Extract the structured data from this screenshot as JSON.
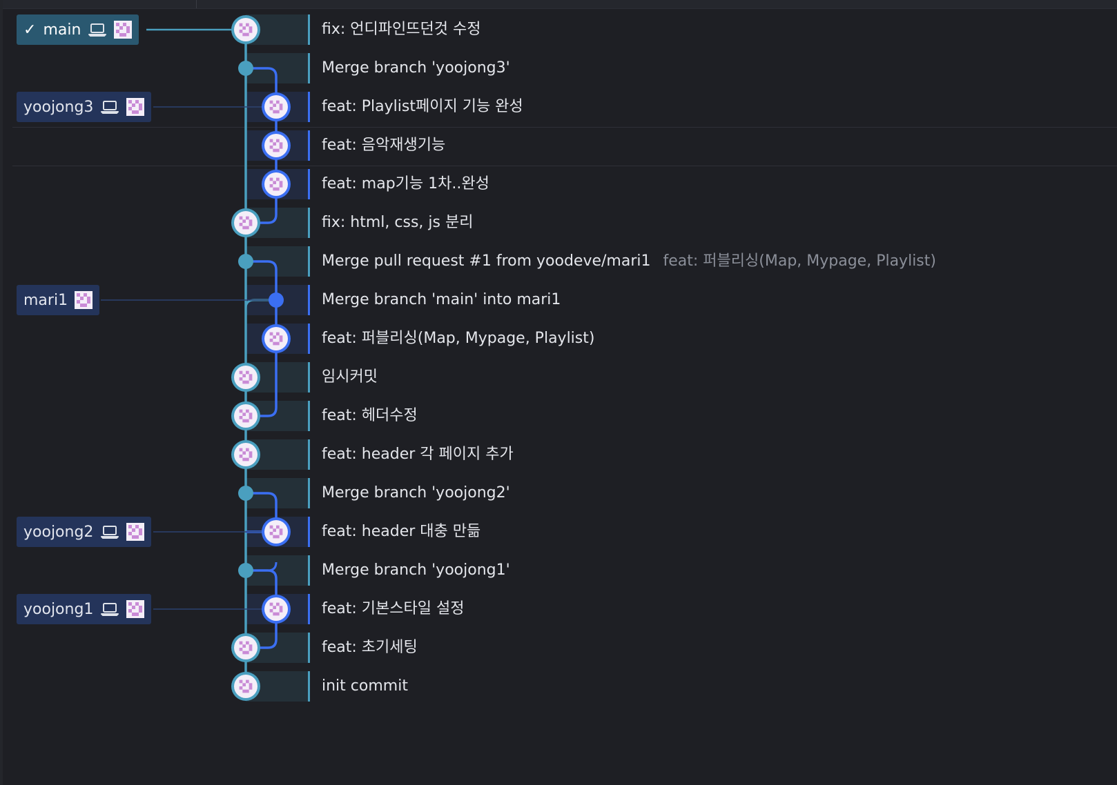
{
  "branches": [
    {
      "name": "main",
      "checked": true,
      "local": true
    },
    {
      "name": "yoojong3",
      "checked": false,
      "local": true
    },
    {
      "name": "mari1",
      "checked": false,
      "local": false
    },
    {
      "name": "yoojong2",
      "checked": false,
      "local": true
    },
    {
      "name": "yoojong1",
      "checked": false,
      "local": true
    }
  ],
  "commits": [
    {
      "message": "fix: 언디파인뜨던것 수정",
      "description": "",
      "branch_label": "main"
    },
    {
      "message": "Merge branch 'yoojong3'",
      "description": "",
      "branch_label": ""
    },
    {
      "message": "feat: Playlist페이지 기능 완성",
      "description": "",
      "branch_label": "yoojong3"
    },
    {
      "message": "feat: 음악재생기능",
      "description": "",
      "branch_label": ""
    },
    {
      "message": "feat: map기능 1차..완성",
      "description": "",
      "branch_label": ""
    },
    {
      "message": "fix: html, css, js 분리",
      "description": "",
      "branch_label": ""
    },
    {
      "message": "Merge pull request #1 from yoodeve/mari1",
      "description": "feat: 퍼블리싱(Map, Mypage, Playlist)",
      "branch_label": ""
    },
    {
      "message": "Merge branch 'main' into mari1",
      "description": "",
      "branch_label": "mari1"
    },
    {
      "message": "feat: 퍼블리싱(Map, Mypage, Playlist)",
      "description": "",
      "branch_label": ""
    },
    {
      "message": "임시커밋",
      "description": "",
      "branch_label": ""
    },
    {
      "message": "feat: 헤더수정",
      "description": "",
      "branch_label": ""
    },
    {
      "message": "feat: header 각 페이지 추가",
      "description": "",
      "branch_label": ""
    },
    {
      "message": "Merge branch 'yoojong2'",
      "description": "",
      "branch_label": ""
    },
    {
      "message": "feat: header 대충 만듦",
      "description": "",
      "branch_label": "yoojong2"
    },
    {
      "message": "Merge branch 'yoojong1'",
      "description": "",
      "branch_label": ""
    },
    {
      "message": "feat: 기본스타일 설정",
      "description": "",
      "branch_label": "yoojong1"
    },
    {
      "message": "feat: 초기세팅",
      "description": "",
      "branch_label": ""
    },
    {
      "message": "init commit",
      "description": "",
      "branch_label": ""
    }
  ],
  "colors": {
    "background": "#1e1f24",
    "lane_main": "#4a9fbf",
    "lane_branch": "#3b6ff2",
    "label_bg": "#24345a",
    "label_main_bg": "#2a5870",
    "row_zone_main": "#243038",
    "row_zone_branch": "#222a3f"
  },
  "icons": {
    "checked": "check-icon",
    "local_branch": "laptop-icon",
    "author": "avatar-icon"
  }
}
